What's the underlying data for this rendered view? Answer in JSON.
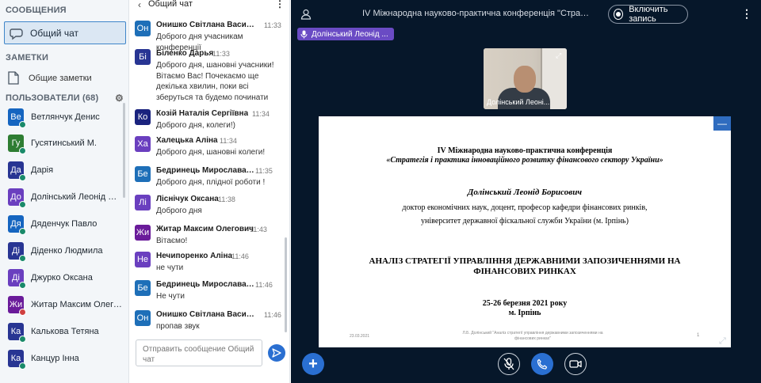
{
  "sidebar": {
    "messages_title": "СООБЩЕНИЯ",
    "public_chat": "Общий чат",
    "notes_title": "ЗАМЕТКИ",
    "shared_notes": "Общие заметки",
    "users_title": "ПОЛЬЗОВАТЕЛИ (68)",
    "users": [
      {
        "initials": "Ве",
        "name": "Ветлянчук Денис",
        "color": "#1565c0",
        "status": "green"
      },
      {
        "initials": "Гу",
        "name": "Гусятинський М.",
        "color": "#2e7d32",
        "status": "green"
      },
      {
        "initials": "Да",
        "name": "Дарія",
        "color": "#283593",
        "status": "green"
      },
      {
        "initials": "До",
        "name": "Долінський Леонід Бори...",
        "color": "#6a3fbf",
        "status": "green"
      },
      {
        "initials": "Дя",
        "name": "Дяденчук Павло",
        "color": "#1565c0",
        "status": "green"
      },
      {
        "initials": "Ді",
        "name": "Діденко Людмила",
        "color": "#283593",
        "status": "green"
      },
      {
        "initials": "Ді",
        "name": "Джурко Оксана",
        "color": "#6a3fbf",
        "status": "green"
      },
      {
        "initials": "Жи",
        "name": "Житар Максим Олегович",
        "color": "#6a1b9a",
        "status": "red"
      },
      {
        "initials": "Ка",
        "name": "Калькова Тетяна",
        "color": "#283593",
        "status": "green"
      },
      {
        "initials": "Ка",
        "name": "Канцур Інна",
        "color": "#283593",
        "status": "green"
      }
    ]
  },
  "chat": {
    "title": "Общий чат",
    "input_placeholder": "Отправить сообщение Общий чат",
    "messages": [
      {
        "initials": "Он",
        "color": "#1e6fb8",
        "name": "Онишко Світлана Василі...",
        "time": "11:33",
        "text": "Доброго дня учасникам конференції"
      },
      {
        "initials": "Бі",
        "color": "#283593",
        "name": "Біленко Дарья",
        "time": "11:33",
        "text": "Доброго дня, шановні учасники! Вітаємо Вас! Почекаємо ще декілька хвилин, поки всі зберуться та будемо починати"
      },
      {
        "initials": "Ко",
        "color": "#1a237e",
        "name": "Козій Наталія Сергіївна",
        "time": "11:34",
        "text": "Доброго дня, колеги!)"
      },
      {
        "initials": "Ха",
        "color": "#6a3fbf",
        "name": "Халецька Аліна",
        "time": "11:34",
        "text": "Доброго дня, шановні колеги!"
      },
      {
        "initials": "Бе",
        "color": "#1e6fb8",
        "name": "Бедринець Мирослава Дм.",
        "time": "11:35",
        "text": "Доброго дня, плідної роботи !"
      },
      {
        "initials": "Лі",
        "color": "#6a3fbf",
        "name": "Ліснічук Оксана",
        "time": "11:38",
        "text": "Доброго дня"
      },
      {
        "initials": "Жи",
        "color": "#6a1b9a",
        "name": "Житар Максим Олегович",
        "time": "11:43",
        "text": "Вітаємо!"
      },
      {
        "initials": "Не",
        "color": "#6a3fbf",
        "name": "Нечипоренко Аліна",
        "time": "11:46",
        "text": "не чути"
      },
      {
        "initials": "Бе",
        "color": "#1e6fb8",
        "name": "Бедринець Мирослава Дм.",
        "time": "11:46",
        "text": "Не чути"
      },
      {
        "initials": "Он",
        "color": "#1e6fb8",
        "name": "Онишко Світлана Василі...",
        "time": "11:46",
        "text": "пропав звук"
      }
    ]
  },
  "main": {
    "meeting_title": "IV Міжнародна науково-практична конференція \"Стратегія і практи...",
    "record_label": "Включить запись",
    "talker": "Долінський Леонід ...",
    "webcam_name": "Долінський Леоні...",
    "slide": {
      "line1": "IV Міжнародна науково-практична конференція",
      "line2": "«Стратегія і практика інноваційного розвитку фінансового сектору України»",
      "line3": "Долінський Леонід Борисович",
      "line4": "доктор економічних наук, доцент, професор кафедри фінансових ринків,",
      "line5": "університет державної фіскальної служби України (м. Ірпінь)",
      "line6": "АНАЛІЗ СТРАТЕГІЇ УПРАВЛІННЯ ДЕРЖАВНИМИ ЗАПОЗИЧЕННЯМИ НА",
      "line7": "ФІНАНСОВИХ РИНКАХ",
      "line8": "25-26 березня 2021 року",
      "line9": "м. Ірпінь",
      "footer_date": "23.03.2021",
      "footer_mid": "Л.Б. Долінський \"Аналіз стратегії управління державними запозиченнями на фінансових ринках\"",
      "footer_num": "1"
    }
  },
  "colors": {
    "accent": "#2a6fd1",
    "main_bg": "#06172a",
    "talker_bg": "#6a4bc4"
  }
}
